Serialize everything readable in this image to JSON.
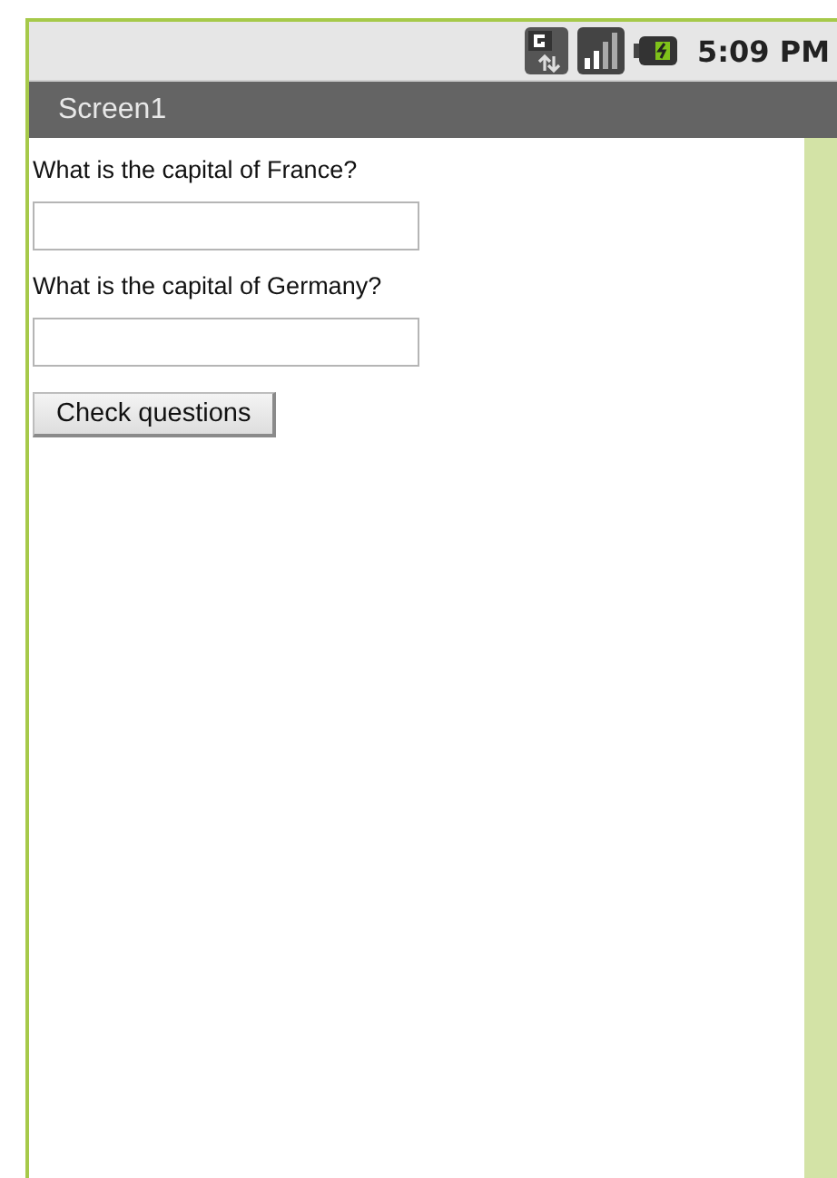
{
  "status_bar": {
    "time": "5:09 PM"
  },
  "title_bar": {
    "title": "Screen1"
  },
  "questions": [
    {
      "label": "What is the capital of France?"
    },
    {
      "label": "What is the capital of Germany?"
    }
  ],
  "button": {
    "label": "Check questions"
  }
}
